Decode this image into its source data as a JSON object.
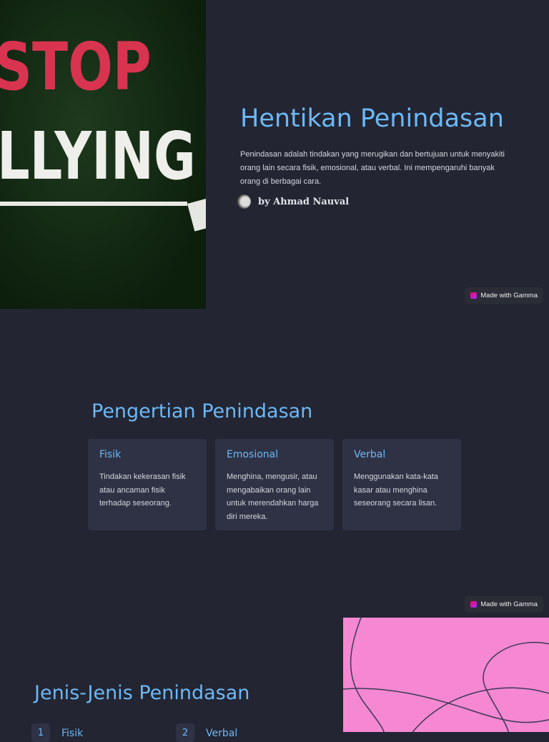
{
  "hero": {
    "image_text": [
      "STOP",
      "BULLYING"
    ],
    "title": "Hentikan Penindasan",
    "intro": "Penindasan adalah tindakan yang merugikan dan bertujuan untuk menyakiti orang lain secara fisik, emosional, atau verbal. Ini mempengaruhi banyak orang di berbagai cara.",
    "author": "by Ahmad Nauval"
  },
  "badge": {
    "label": "Made with Gamma"
  },
  "definition": {
    "title": "Pengertian Penindasan",
    "cards": [
      {
        "title": "Fisik",
        "text": "Tindakan kekerasan fisik atau ancaman fisik terhadap seseorang."
      },
      {
        "title": "Emosional",
        "text": "Menghina, mengusir, atau mengabaikan orang lain untuk merendahkan harga diri mereka."
      },
      {
        "title": "Verbal",
        "text": "Menggunakan kata-kata kasar atau menghina seseorang secara lisan."
      }
    ]
  },
  "types": {
    "title": "Jenis-Jenis Penindasan",
    "items": [
      {
        "num": "1",
        "label": "Fisik"
      },
      {
        "num": "2",
        "label": "Verbal"
      }
    ]
  }
}
